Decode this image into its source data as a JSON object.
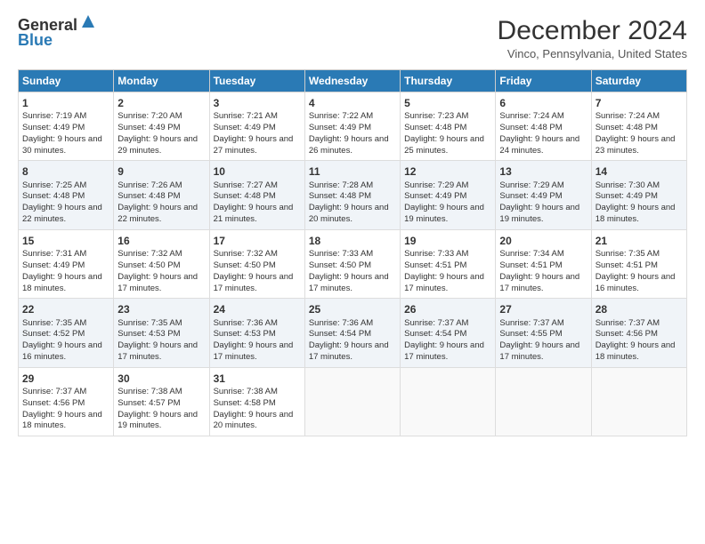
{
  "logo": {
    "line1": "General",
    "line2": "Blue"
  },
  "title": "December 2024",
  "subtitle": "Vinco, Pennsylvania, United States",
  "days": [
    "Sunday",
    "Monday",
    "Tuesday",
    "Wednesday",
    "Thursday",
    "Friday",
    "Saturday"
  ],
  "weeks": [
    [
      {
        "num": "1",
        "rise": "Sunrise: 7:19 AM",
        "set": "Sunset: 4:49 PM",
        "light": "Daylight: 9 hours and 30 minutes."
      },
      {
        "num": "2",
        "rise": "Sunrise: 7:20 AM",
        "set": "Sunset: 4:49 PM",
        "light": "Daylight: 9 hours and 29 minutes."
      },
      {
        "num": "3",
        "rise": "Sunrise: 7:21 AM",
        "set": "Sunset: 4:49 PM",
        "light": "Daylight: 9 hours and 27 minutes."
      },
      {
        "num": "4",
        "rise": "Sunrise: 7:22 AM",
        "set": "Sunset: 4:49 PM",
        "light": "Daylight: 9 hours and 26 minutes."
      },
      {
        "num": "5",
        "rise": "Sunrise: 7:23 AM",
        "set": "Sunset: 4:48 PM",
        "light": "Daylight: 9 hours and 25 minutes."
      },
      {
        "num": "6",
        "rise": "Sunrise: 7:24 AM",
        "set": "Sunset: 4:48 PM",
        "light": "Daylight: 9 hours and 24 minutes."
      },
      {
        "num": "7",
        "rise": "Sunrise: 7:24 AM",
        "set": "Sunset: 4:48 PM",
        "light": "Daylight: 9 hours and 23 minutes."
      }
    ],
    [
      {
        "num": "8",
        "rise": "Sunrise: 7:25 AM",
        "set": "Sunset: 4:48 PM",
        "light": "Daylight: 9 hours and 22 minutes."
      },
      {
        "num": "9",
        "rise": "Sunrise: 7:26 AM",
        "set": "Sunset: 4:48 PM",
        "light": "Daylight: 9 hours and 22 minutes."
      },
      {
        "num": "10",
        "rise": "Sunrise: 7:27 AM",
        "set": "Sunset: 4:48 PM",
        "light": "Daylight: 9 hours and 21 minutes."
      },
      {
        "num": "11",
        "rise": "Sunrise: 7:28 AM",
        "set": "Sunset: 4:48 PM",
        "light": "Daylight: 9 hours and 20 minutes."
      },
      {
        "num": "12",
        "rise": "Sunrise: 7:29 AM",
        "set": "Sunset: 4:49 PM",
        "light": "Daylight: 9 hours and 19 minutes."
      },
      {
        "num": "13",
        "rise": "Sunrise: 7:29 AM",
        "set": "Sunset: 4:49 PM",
        "light": "Daylight: 9 hours and 19 minutes."
      },
      {
        "num": "14",
        "rise": "Sunrise: 7:30 AM",
        "set": "Sunset: 4:49 PM",
        "light": "Daylight: 9 hours and 18 minutes."
      }
    ],
    [
      {
        "num": "15",
        "rise": "Sunrise: 7:31 AM",
        "set": "Sunset: 4:49 PM",
        "light": "Daylight: 9 hours and 18 minutes."
      },
      {
        "num": "16",
        "rise": "Sunrise: 7:32 AM",
        "set": "Sunset: 4:50 PM",
        "light": "Daylight: 9 hours and 17 minutes."
      },
      {
        "num": "17",
        "rise": "Sunrise: 7:32 AM",
        "set": "Sunset: 4:50 PM",
        "light": "Daylight: 9 hours and 17 minutes."
      },
      {
        "num": "18",
        "rise": "Sunrise: 7:33 AM",
        "set": "Sunset: 4:50 PM",
        "light": "Daylight: 9 hours and 17 minutes."
      },
      {
        "num": "19",
        "rise": "Sunrise: 7:33 AM",
        "set": "Sunset: 4:51 PM",
        "light": "Daylight: 9 hours and 17 minutes."
      },
      {
        "num": "20",
        "rise": "Sunrise: 7:34 AM",
        "set": "Sunset: 4:51 PM",
        "light": "Daylight: 9 hours and 17 minutes."
      },
      {
        "num": "21",
        "rise": "Sunrise: 7:35 AM",
        "set": "Sunset: 4:51 PM",
        "light": "Daylight: 9 hours and 16 minutes."
      }
    ],
    [
      {
        "num": "22",
        "rise": "Sunrise: 7:35 AM",
        "set": "Sunset: 4:52 PM",
        "light": "Daylight: 9 hours and 16 minutes."
      },
      {
        "num": "23",
        "rise": "Sunrise: 7:35 AM",
        "set": "Sunset: 4:53 PM",
        "light": "Daylight: 9 hours and 17 minutes."
      },
      {
        "num": "24",
        "rise": "Sunrise: 7:36 AM",
        "set": "Sunset: 4:53 PM",
        "light": "Daylight: 9 hours and 17 minutes."
      },
      {
        "num": "25",
        "rise": "Sunrise: 7:36 AM",
        "set": "Sunset: 4:54 PM",
        "light": "Daylight: 9 hours and 17 minutes."
      },
      {
        "num": "26",
        "rise": "Sunrise: 7:37 AM",
        "set": "Sunset: 4:54 PM",
        "light": "Daylight: 9 hours and 17 minutes."
      },
      {
        "num": "27",
        "rise": "Sunrise: 7:37 AM",
        "set": "Sunset: 4:55 PM",
        "light": "Daylight: 9 hours and 17 minutes."
      },
      {
        "num": "28",
        "rise": "Sunrise: 7:37 AM",
        "set": "Sunset: 4:56 PM",
        "light": "Daylight: 9 hours and 18 minutes."
      }
    ],
    [
      {
        "num": "29",
        "rise": "Sunrise: 7:37 AM",
        "set": "Sunset: 4:56 PM",
        "light": "Daylight: 9 hours and 18 minutes."
      },
      {
        "num": "30",
        "rise": "Sunrise: 7:38 AM",
        "set": "Sunset: 4:57 PM",
        "light": "Daylight: 9 hours and 19 minutes."
      },
      {
        "num": "31",
        "rise": "Sunrise: 7:38 AM",
        "set": "Sunset: 4:58 PM",
        "light": "Daylight: 9 hours and 20 minutes."
      },
      null,
      null,
      null,
      null
    ]
  ]
}
